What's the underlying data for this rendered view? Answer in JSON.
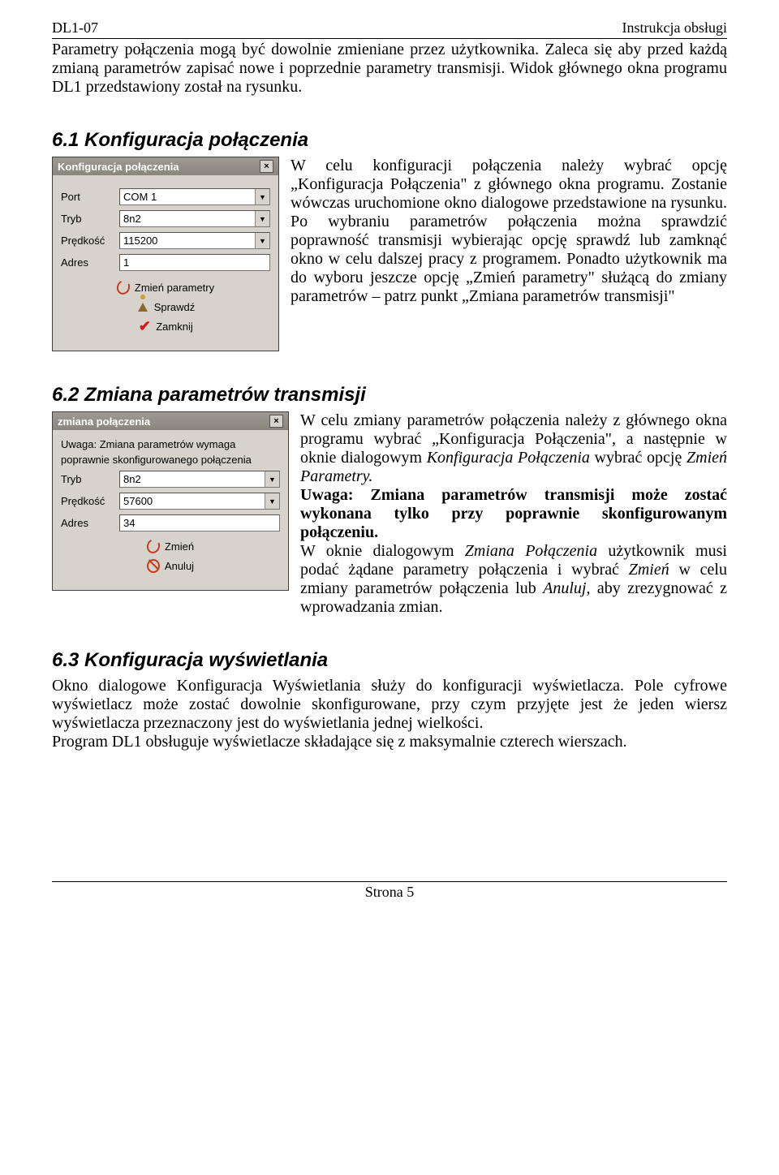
{
  "header": {
    "left": "DL1-07",
    "right": "Instrukcja obsługi"
  },
  "intro": "Parametry połączenia mogą być dowolnie zmieniane przez użytkownika. Zaleca się aby przed każdą zmianą parametrów zapisać nowe i poprzednie parametry transmisji. Widok głównego okna programu DL1 przedstawiony został na rysunku.",
  "section61": {
    "title": "6.1  Konfiguracja połączenia",
    "text": "W celu konfiguracji połączenia należy wybrać opcję „Konfiguracja Połączenia\" z głównego okna programu. Zostanie wówczas uruchomione okno dialogowe przedstawione na rysunku.\nPo wybraniu parametrów połączenia można sprawdzić poprawność transmisji wybierając opcję sprawdź lub zamknąć okno w celu dalszej pracy z programem. Ponadto użytkownik ma do wyboru jeszcze opcję „Zmień parametry\" służącą do zmiany parametrów – patrz punkt „Zmiana parametrów transmisji\""
  },
  "dialog1": {
    "title": "Konfiguracja połączenia",
    "labels": {
      "port": "Port",
      "tryb": "Tryb",
      "predkosc": "Prędkość",
      "adres": "Adres"
    },
    "values": {
      "port": "COM 1",
      "tryb": "8n2",
      "predkosc": "115200",
      "adres": "1"
    },
    "buttons": {
      "zmien": "Zmień parametry",
      "sprawdz": "Sprawdź",
      "zamknij": "Zamknij"
    }
  },
  "section62": {
    "title": "6.2  Zmiana parametrów transmisji",
    "p1": "W celu zmiany parametrów połączenia należy z głównego okna programu wybrać „Konfiguracja Połączenia\", a następnie w oknie dialogowym ",
    "p1i1": "Konfiguracja Połączenia",
    "p1m": " wybrać opcję ",
    "p1i2": "Zmień Parametry.",
    "p2b": "Uwaga: Zmiana parametrów transmisji może zostać wykonana tylko przy poprawnie skonfigurowanym połączeniu.",
    "p3a": "W oknie dialogowym ",
    "p3i1": "Zmiana Połączenia",
    "p3b": " użytkownik musi podać żądane parametry połączenia i wybrać ",
    "p3i2": "Zmień",
    "p3c": " w celu zmiany parametrów połączenia lub ",
    "p3i3": "Anuluj,",
    "p3d": " aby zrezygnować z wprowadzania zmian."
  },
  "dialog2": {
    "title": "zmiana połączenia",
    "warn1": "Uwaga: Zmiana parametrów wymaga",
    "warn2": "poprawnie skonfigurowanego  połączenia",
    "labels": {
      "tryb": "Tryb",
      "predkosc": "Prędkość",
      "adres": "Adres"
    },
    "values": {
      "tryb": "8n2",
      "predkosc": "57600",
      "adres": "34"
    },
    "buttons": {
      "zmien": "Zmień",
      "anuluj": "Anuluj"
    }
  },
  "section63": {
    "title": "6.3  Konfiguracja wyświetlania",
    "p1a": "Okno dialogowe ",
    "p1i": "Konfiguracja Wyświetlania",
    "p1b": " służy do konfiguracji wyświetlacza. Pole cyfrowe wyświetlacz może zostać dowolnie skonfigurowane, przy czym przyjęte jest że jeden wiersz wyświetlacza przeznaczony jest do wyświetlania jednej wielkości.",
    "p2": "Program DL1 obsługuje wyświetlacze składające się z maksymalnie czterech wierszach."
  },
  "footer": "Strona 5"
}
